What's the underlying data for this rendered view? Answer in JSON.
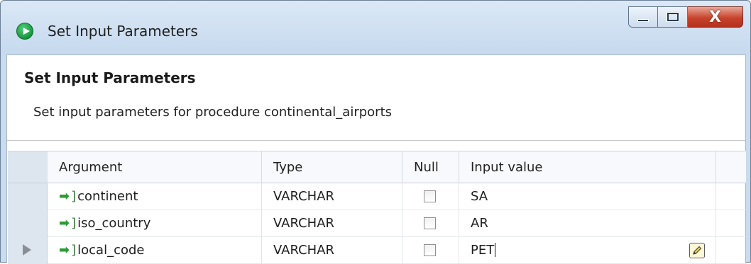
{
  "window": {
    "title": "Set Input Parameters",
    "icon": "play-circle-icon",
    "controls": {
      "minimize": "minimize-icon",
      "maximize": "maximize-icon",
      "close": "X"
    }
  },
  "dialog": {
    "heading": "Set Input Parameters",
    "subtitle": "Set input parameters for procedure continental_airports"
  },
  "grid": {
    "columns": [
      "Argument",
      "Type",
      "Null",
      "Input value"
    ],
    "rows": [
      {
        "argument": "continent",
        "type": "VARCHAR",
        "null": false,
        "value": "SA",
        "icon": "input-arrow-icon"
      },
      {
        "argument": "iso_country",
        "type": "VARCHAR",
        "null": false,
        "value": "AR",
        "icon": "input-arrow-icon"
      },
      {
        "argument": "local_code",
        "type": "VARCHAR",
        "null": false,
        "value": "PET",
        "icon": "input-arrow-icon",
        "current": true,
        "editing": true
      }
    ]
  },
  "colors": {
    "titlebar": "#c9dcef",
    "close_button": "#c8432c",
    "arrow_icon": "#2a9d34",
    "row_header": "#dde5ef"
  }
}
